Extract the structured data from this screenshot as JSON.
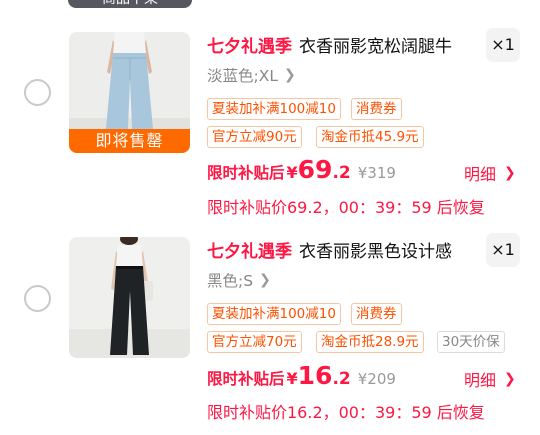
{
  "header": {
    "tag_label": "商品下架"
  },
  "items": [
    {
      "promo": "七夕礼遇季",
      "title": "衣香丽影宽松阔腿牛",
      "quantity": "×1",
      "spec": "淡蓝色;XL",
      "image_banner": "即将售罄",
      "tags_row1": [
        "夏装加补满100减10",
        "消费券"
      ],
      "tags_row2": [
        "官方立减90元",
        "淘金币抵45.9元"
      ],
      "price_label": "限时补贴后",
      "price_currency": "¥",
      "price_int": "69",
      "price_dec": ".2",
      "price_original": "¥319",
      "detail_label": "明细",
      "countdown": "限时补贴价69.2，00：39：59 后恢复",
      "image_colors": {
        "jeans": "#a9c7dc",
        "top": "#f4f4f4",
        "bg": "#ededeb"
      }
    },
    {
      "promo": "七夕礼遇季",
      "title": "衣香丽影黑色设计感",
      "quantity": "×1",
      "spec": "黑色;S",
      "tags_row1": [
        "夏装加补满100减10",
        "消费券"
      ],
      "tags_row2": [
        "官方立减70元",
        "淘金币抵28.9元",
        "30天价保"
      ],
      "price_label": "限时补贴后",
      "price_currency": "¥",
      "price_int": "16",
      "price_dec": ".2",
      "price_original": "¥209",
      "detail_label": "明细",
      "countdown": "限时补贴价16.2，00：39：59 后恢复",
      "image_colors": {
        "pants": "#1f2326",
        "top": "#f5f5f5",
        "bg": "#efefed"
      }
    }
  ],
  "colors": {
    "accent": "#ff1744",
    "orange": "#ff5000",
    "sale_banner": "#ff6a00"
  },
  "icons": [
    "radio-circle-icon",
    "chevron-right-icon"
  ]
}
